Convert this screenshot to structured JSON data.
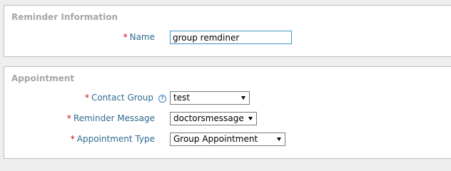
{
  "reminder_info": {
    "legend": "Reminder Information",
    "name": {
      "required": "*",
      "label": "Name",
      "value": "group remdiner"
    }
  },
  "appointment": {
    "legend": "Appointment",
    "contact_group": {
      "required": "*",
      "label": "Contact Group",
      "help_icon": "?",
      "value": "test"
    },
    "reminder_message": {
      "required": "*",
      "label": "Reminder Message",
      "value": "doctorsmessage"
    },
    "appointment_type": {
      "required": "*",
      "label": "Appointment Type",
      "value": "Group Appointment"
    }
  },
  "colors": {
    "label": "#2e6a8e",
    "required": "#d9001b",
    "legend": "#a6a6a6",
    "input_border": "#3a96c4"
  }
}
